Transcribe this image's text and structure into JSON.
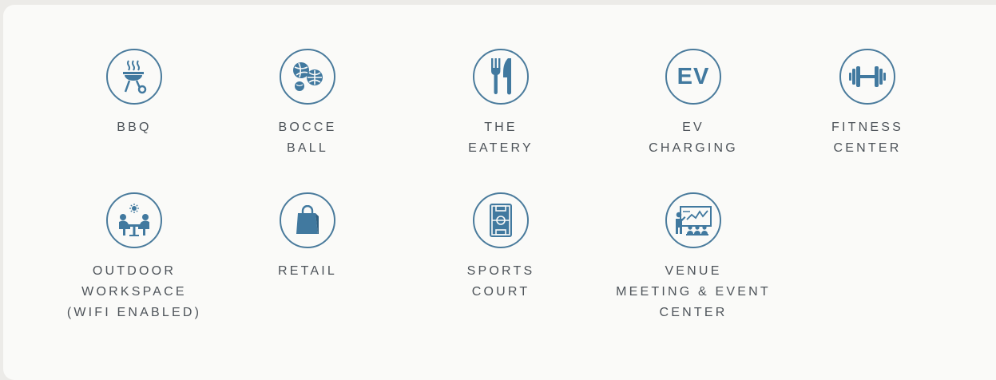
{
  "amenities": [
    {
      "id": "bbq",
      "icon": "bbq-grill-icon",
      "lines": [
        "BBQ"
      ]
    },
    {
      "id": "bocce",
      "icon": "bocce-balls-icon",
      "lines": [
        "BOCCE",
        "BALL"
      ]
    },
    {
      "id": "eatery",
      "icon": "fork-knife-icon",
      "lines": [
        "THE",
        "EATERY"
      ]
    },
    {
      "id": "ev",
      "icon": "ev-icon",
      "icon_text": "EV",
      "lines": [
        "EV",
        "CHARGING"
      ]
    },
    {
      "id": "fitness",
      "icon": "dumbbell-icon",
      "lines": [
        "FITNESS",
        "CENTER"
      ]
    },
    {
      "id": "workspace",
      "icon": "outdoor-workspace-icon",
      "lines": [
        "OUTDOOR",
        "WORKSPACE",
        "(WIFI ENABLED)"
      ]
    },
    {
      "id": "retail",
      "icon": "shopping-bag-icon",
      "lines": [
        "RETAIL"
      ]
    },
    {
      "id": "sports",
      "icon": "sports-court-icon",
      "lines": [
        "SPORTS",
        "COURT"
      ]
    },
    {
      "id": "venue",
      "icon": "presentation-icon",
      "lines": [
        "VENUE",
        "MEETING & EVENT",
        "CENTER"
      ]
    }
  ],
  "colors": {
    "accent": "#41799f",
    "text": "#4d5359",
    "panel": "#fafaf8",
    "background": "#ecebe8"
  }
}
